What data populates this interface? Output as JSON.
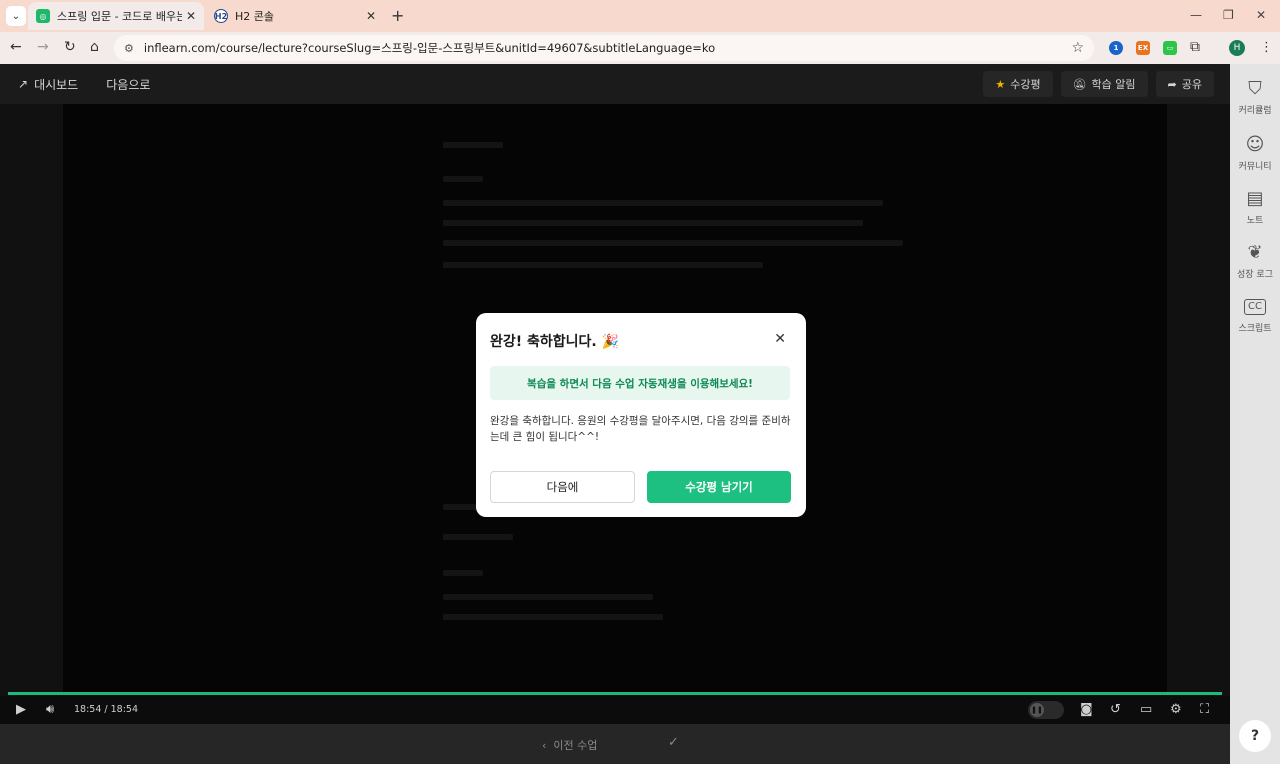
{
  "browser": {
    "tabs": [
      {
        "title": "스프링 입문 - 코드로 배우는 스",
        "active": true
      },
      {
        "title": "H2 콘솔",
        "active": false
      }
    ],
    "url": "inflearn.com/course/lecture?courseSlug=스프링-입문-스프링부트&unitId=49607&subtitleLanguage=ko",
    "avatar_letter": "H",
    "ext_labels": [
      "1",
      "EX",
      "▭"
    ]
  },
  "header": {
    "dashboard_label": "대시보드",
    "next_label": "다음으로",
    "review_label": "수강평",
    "notify_label": "학습 알림",
    "share_label": "공유"
  },
  "player": {
    "time": "18:54 / 18:54",
    "progress": 1.0
  },
  "bottom": {
    "prev_label": "이전 수업"
  },
  "sidebar": {
    "items": [
      {
        "label": "커리큘럼",
        "icon": "hat-icon"
      },
      {
        "label": "커뮤니티",
        "icon": "chat-icon"
      },
      {
        "label": "노트",
        "icon": "note-icon"
      },
      {
        "label": "성장 로그",
        "icon": "leaf-icon"
      },
      {
        "label": "스크립트",
        "icon": "cc-icon"
      }
    ],
    "help": "?"
  },
  "modal": {
    "title": "완강! 축하합니다. 🎉",
    "banner": "복습을 하면서 다음 수업 자동재생을 이용해보세요!",
    "body": "완강을 축하합니다. 응원의 수강평을 달아주시면, 다음 강의를 준비하는데 큰 힘이 됩니다^^!",
    "later_label": "다음에",
    "review_label": "수강평 남기기"
  },
  "colors": {
    "accent": "#1dc080",
    "banner_text": "#0c8a52",
    "tabbar": "#f7d9cd"
  }
}
